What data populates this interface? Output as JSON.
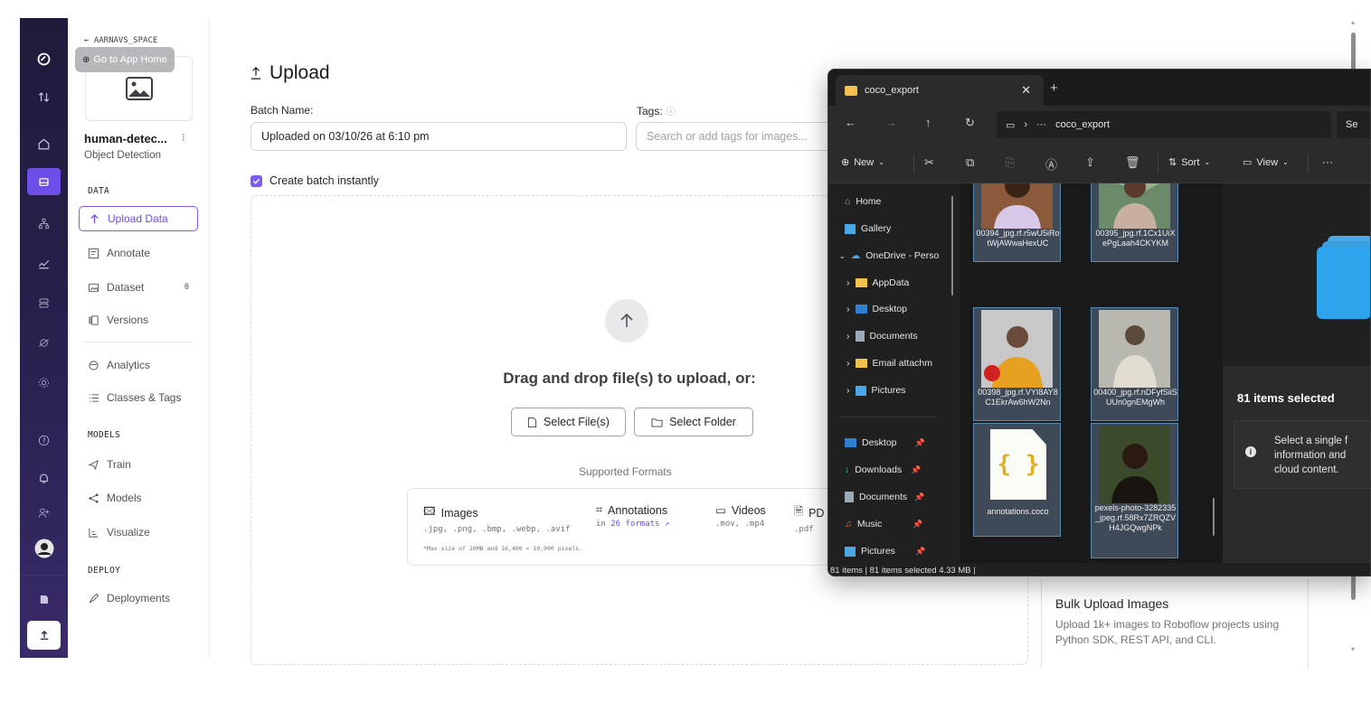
{
  "sidebar": {
    "back_label": "← AARNAVS_SPACE",
    "tooltip": "Go to App Home",
    "project_name": "human-detec...",
    "project_type": "Object Detection",
    "sections": {
      "data": "DATA",
      "models": "MODELS",
      "deploy": "DEPLOY"
    },
    "data_items": [
      {
        "label": "Upload Data",
        "icon": "arrow-up-icon"
      },
      {
        "label": "Annotate",
        "icon": "annotate-icon"
      },
      {
        "label": "Dataset",
        "icon": "image-icon",
        "badge": "0"
      },
      {
        "label": "Versions",
        "icon": "versions-icon"
      }
    ],
    "analytics_items": [
      {
        "label": "Analytics",
        "icon": "analytics-icon"
      },
      {
        "label": "Classes & Tags",
        "icon": "list-icon"
      }
    ],
    "model_items": [
      {
        "label": "Train",
        "icon": "train-icon"
      },
      {
        "label": "Models",
        "icon": "models-icon"
      },
      {
        "label": "Visualize",
        "icon": "visualize-icon"
      }
    ],
    "deploy_items": [
      {
        "label": "Deployments",
        "icon": "rocket-icon"
      }
    ]
  },
  "main": {
    "title": "Upload",
    "batch_label": "Batch Name:",
    "batch_value": "Uploaded on 03/10/26 at 6:10 pm",
    "tags_label": "Tags:",
    "tags_placeholder": "Search or add tags for images...",
    "create_batch_label": "Create batch instantly",
    "create_batch_checked": true,
    "drop_text": "Drag and drop file(s) to upload, or:",
    "select_files": "Select File(s)",
    "select_folder": "Select Folder",
    "supported_formats": "Supported Formats",
    "formats": {
      "images_title": "Images",
      "images_ext": ".jpg, .png, .bmp, .webp, .avif",
      "annotations_title": "Annotations",
      "annotations_in": "in",
      "annotations_link": "26 formats ↗",
      "videos_title": "Videos",
      "videos_ext": ".mov, .mp4",
      "pdf_title": "PD",
      "pdf_ext": ".pdf",
      "max_size": "*Max size of 20MB and 16,400 × 10,900 pixels."
    }
  },
  "bulk_card": {
    "title": "Bulk Upload Images",
    "desc": "Upload 1k+ images to Roboflow projects using Python SDK, REST API, and CLI."
  },
  "explorer": {
    "tab_title": "coco_export",
    "path_more": "···",
    "path_folder": "coco_export",
    "search_stub": "Se",
    "cmd": {
      "new": "New",
      "sort": "Sort",
      "view": "View",
      "more": "···"
    },
    "tree": [
      {
        "label": "Home",
        "icon": "home-icon"
      },
      {
        "label": "Gallery",
        "icon": "gallery-icon"
      },
      {
        "label": "OneDrive - Perso",
        "icon": "onedrive-icon"
      },
      {
        "label": "AppData",
        "icon": "folder-icon"
      },
      {
        "label": "Desktop",
        "icon": "desktop-icon"
      },
      {
        "label": "Documents",
        "icon": "documents-icon"
      },
      {
        "label": "Email attachm",
        "icon": "folder-icon"
      },
      {
        "label": "Pictures",
        "icon": "pictures-icon"
      }
    ],
    "quick": [
      {
        "label": "Desktop",
        "icon": "desktop-icon"
      },
      {
        "label": "Downloads",
        "icon": "download-icon"
      },
      {
        "label": "Documents",
        "icon": "documents-icon"
      },
      {
        "label": "Music",
        "icon": "music-icon"
      },
      {
        "label": "Pictures",
        "icon": "pictures-icon"
      }
    ],
    "files": [
      {
        "name": "00394_jpg.rf.r5wU5iRotWjAWwaHexUC"
      },
      {
        "name": "00395_jpg.rf.1Cx1UiXePgLaah4CKYKM"
      },
      {
        "name": "00398_jpg.rf.VYI8AY8C1EkrAw6hW2Nn"
      },
      {
        "name": "00400_jpg.rf.nDFyfSiiSUUn0gnEMgWh"
      },
      {
        "name": "annotations.coco"
      },
      {
        "name": "pexels-photo-3282335_jpeg.rf.58Rx7ZRQZVH4JGQwgNPk"
      }
    ],
    "selected_text": "81 items selected",
    "info_text": "Select a single f information and cloud content.",
    "status": "81 items  |  81 items selected  4.33 MB  |"
  },
  "colors": {
    "accent": "#6d4ee6",
    "rail": "#231d42",
    "explorer_bg": "#202020",
    "tile_sel": "#3e4a57"
  }
}
